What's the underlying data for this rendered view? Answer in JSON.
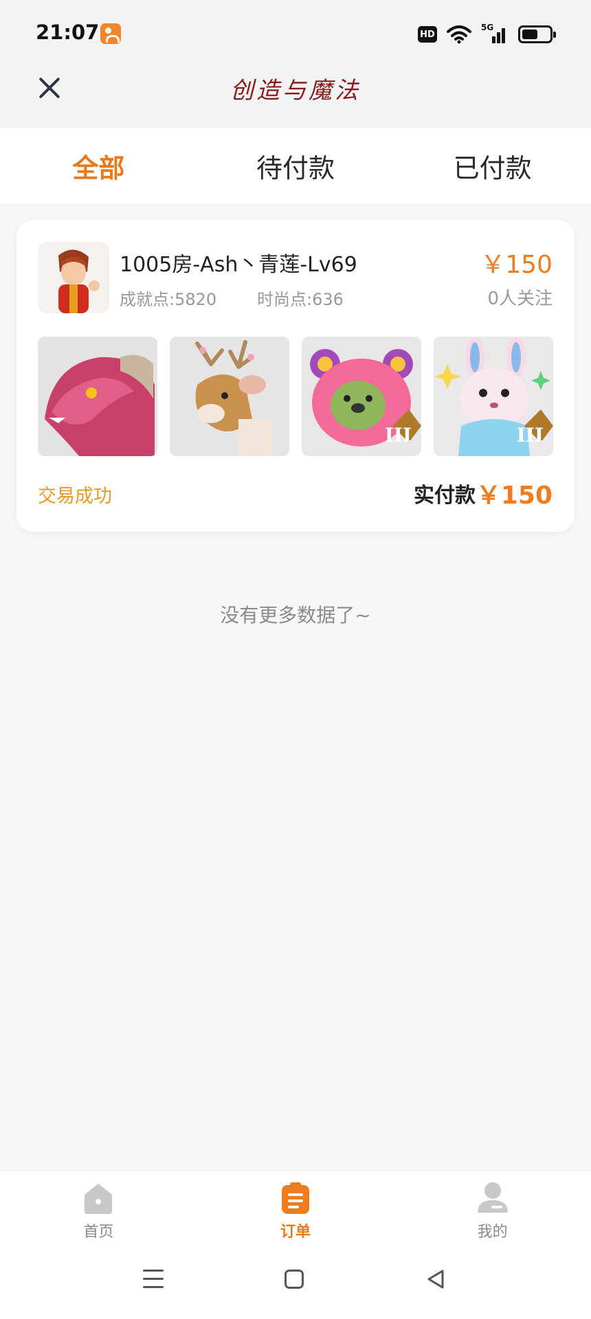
{
  "status_bar": {
    "time": "21:07",
    "network_badge": "HD",
    "network_type": "5G",
    "icons": [
      "app-notification-icon",
      "wifi-icon",
      "signal-icon",
      "battery-icon"
    ]
  },
  "header": {
    "title": "创造与魔法",
    "close_icon": "close-icon"
  },
  "tabs": [
    {
      "label": "全部",
      "active": true
    },
    {
      "label": "待付款",
      "active": false
    },
    {
      "label": "已付款",
      "active": false
    }
  ],
  "order": {
    "seller": "1005房-Ash丶青莲-Lv69",
    "achievement_points": "成就点:5820",
    "fashion_points": "时尚点:636",
    "price": "￥150",
    "followers": "0人关注",
    "items": [
      {
        "name": "dragon-mount-thumbnail"
      },
      {
        "name": "deer-mount-thumbnail"
      },
      {
        "name": "pink-bear-thumbnail",
        "badge": "III"
      },
      {
        "name": "bunny-thumbnail",
        "badge": "III"
      }
    ],
    "status": "交易成功",
    "paid_label": "实付款",
    "paid_amount": "￥150"
  },
  "list_end": "没有更多数据了~",
  "bottom_nav": [
    {
      "label": "首页",
      "icon": "home-icon",
      "active": false
    },
    {
      "label": "订单",
      "icon": "order-icon",
      "active": true
    },
    {
      "label": "我的",
      "icon": "profile-icon",
      "active": false
    }
  ],
  "colors": {
    "accent": "#ef7d1d",
    "status_success": "#e89a1b"
  }
}
